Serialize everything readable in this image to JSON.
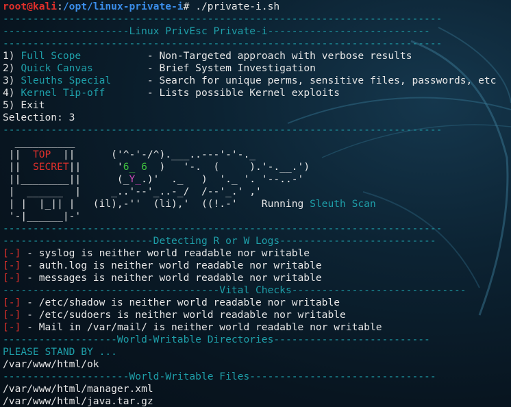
{
  "terminal": {
    "prompt": {
      "user_host": "root@kali",
      "colon": ":",
      "path": "/opt/linux-private-i",
      "symbol": "# ",
      "command": "./private-i.sh"
    },
    "rule": "-------------------------------------------------------------------------",
    "title_line": "---------------------Linux PrivEsc Private-i---------------------------",
    "menu": [
      {
        "num": "1) ",
        "name": "Full Scope",
        "pad": "           ",
        "desc": "- Non-Targeted approach with verbose results"
      },
      {
        "num": "2) ",
        "name": "Quick Canvas",
        "pad": "         ",
        "desc": "- Brief System Investigation"
      },
      {
        "num": "3) ",
        "name": "Sleuths Special",
        "pad": "      ",
        "desc": "- Search for unique perms, sensitive files, passwords, etc"
      },
      {
        "num": "4) ",
        "name": "Kernel Tip-off",
        "pad": "       ",
        "desc": "- Lists possible Kernel exploits"
      },
      {
        "num": "5) ",
        "name": "Exit",
        "pad": "",
        "desc": ""
      }
    ],
    "selection": "Selection: 3",
    "art": {
      "l1": "  __________",
      "l2a": " ||  ",
      "l2b": "TOP",
      "l2c": "  ||      ('^-'-/^).___..---'-'-._",
      "l3a": " ||  ",
      "l3b": "SECRET",
      "l3c": "||      '",
      "l3d": "6_ 6",
      "l3e": "  )   '-.  (     ).'-.__.')",
      "l4a": " ||________||      (_",
      "l4b": "Y_",
      "l4c": ".)'  ._   )  '._ '. '--..-'",
      "l5": " |  ______  |     _..'--'_..-_/  /--'_.' ,'",
      "l6a": " | |  |_|| |   (il),-''  (li),'  ((!.-'    Running ",
      "l6b": "Sleuth Scan",
      "l7": " '-|______|-'"
    },
    "logs_header": "-------------------------Detecting R or W Logs--------------------------",
    "fail_marker": "[-]",
    "log_results": [
      " - syslog is neither world readable nor writable",
      " - auth.log is neither world readable nor writable",
      " - messages is neither world readable nor writable"
    ],
    "vital_header": "------------------------------------Vital Checks-----------------------------",
    "vital_results": [
      " - /etc/shadow is neither world readable nor writable",
      " - /etc/sudoers is neither world readable nor writable",
      " - Mail in /var/mail/ is neither world readable nor writable"
    ],
    "ww_dirs_header": "-------------------World-Writable Directories--------------------------",
    "stand_by": "PLEASE STAND BY ...",
    "ww_dirs": [
      "/var/www/html/ok"
    ],
    "ww_files_header": "---------------------World-Writable Files-------------------------------",
    "ww_files": [
      "/var/www/html/manager.xml",
      "/var/www/html/java.tar.gz"
    ]
  }
}
